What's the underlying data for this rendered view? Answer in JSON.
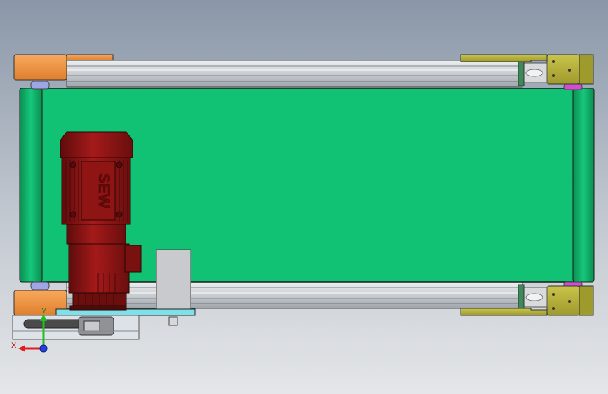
{
  "viewport": {
    "background_top": "#8a97a8",
    "background_bottom": "#e4e6e8"
  },
  "conveyor": {
    "belt_color": "#11c174",
    "roller_color": "#0ea85f",
    "rail_color": "#c9cdd2",
    "left_end_plate_color": "#f39a4c",
    "right_end_plate_color": "#b7b23a"
  },
  "motor": {
    "brand_text": "SEW",
    "body_color": "#8b1414"
  },
  "triad": {
    "x_label": "X",
    "y_label": "Y",
    "x_color": "#e02020",
    "y_color": "#20c020",
    "z_color": "#2040e0"
  }
}
